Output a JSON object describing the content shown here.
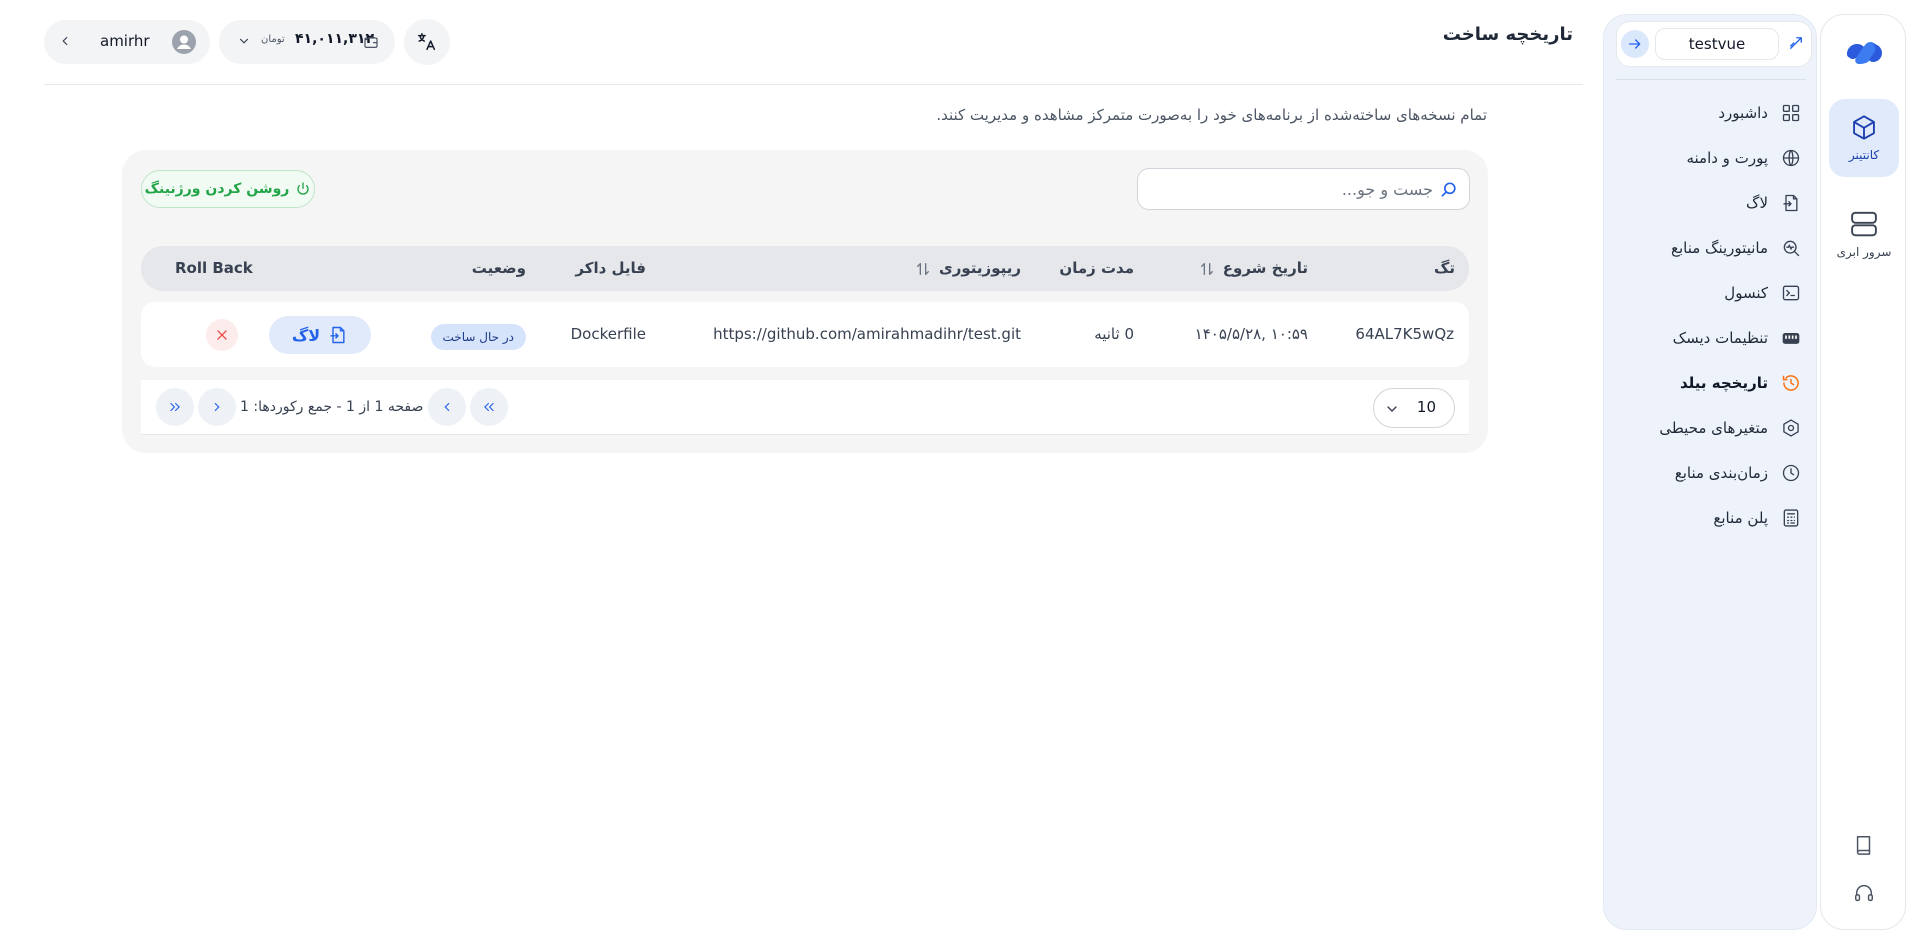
{
  "header": {
    "title": "تاریخچه ساخت",
    "subtitle": "تمام نسخه‌های ساخته‌شده از برنامه‌های خود را به‌صورت متمرکز مشاهده و مدیریت کنند.",
    "user_name": "amirhr",
    "balance": "۴۱,۰۱۱,۳۱۲",
    "currency": "تومان"
  },
  "rail": {
    "items": [
      {
        "label": "کانتینر",
        "icon": "cube-icon",
        "active": true
      },
      {
        "label": "سرور ابری",
        "icon": "server-icon",
        "active": false
      }
    ],
    "bottom_icons": [
      "book-icon",
      "headset-icon"
    ]
  },
  "sidebar": {
    "project": "testvue",
    "items": [
      {
        "label": "داشبورد",
        "icon": "grid-icon"
      },
      {
        "label": "پورت و دامنه",
        "icon": "globe-icon"
      },
      {
        "label": "لاگ",
        "icon": "log-file-icon"
      },
      {
        "label": "مانیتورینگ منابع",
        "icon": "monitoring-icon"
      },
      {
        "label": "کنسول",
        "icon": "terminal-icon"
      },
      {
        "label": "تنظیمات دیسک",
        "icon": "disk-icon"
      },
      {
        "label": "تاریخچه بیلد",
        "icon": "history-icon",
        "active": true
      },
      {
        "label": "متغیرهای محیطی",
        "icon": "hexagon-icon"
      },
      {
        "label": "زمان‌بندی منابع",
        "icon": "clock-icon"
      },
      {
        "label": "پلن منابع",
        "icon": "calculator-icon"
      }
    ]
  },
  "toolbar": {
    "search_placeholder": "جست و جو...",
    "versioning_label": "روشن کردن ورژنینگ"
  },
  "table": {
    "columns": {
      "tag": "تگ",
      "start_date": "تاریخ شروع",
      "duration": "مدت زمان",
      "repository": "ریپوزیتوری",
      "dockerfile": "فایل داکر",
      "status": "وضعیت",
      "rollback": "Roll Back"
    },
    "rows": [
      {
        "tag": "64AL7K5wQz",
        "start_date": "۱۴۰۵/۵/۲۸, ۱۰:۵۹",
        "duration": "0 ثانیه",
        "repository": "https://github.com/amirahmadihr/test.git",
        "dockerfile": "Dockerfile",
        "status": "در حال ساخت",
        "log_label": "لاگ"
      }
    ]
  },
  "pagination": {
    "summary": "صفحه 1 از 1 - جمع رکوردها: 1",
    "page_size": "10"
  },
  "colors": {
    "accent": "#2563eb",
    "success": "#22a447",
    "danger": "#ef4444",
    "active_history": "#f97316"
  }
}
